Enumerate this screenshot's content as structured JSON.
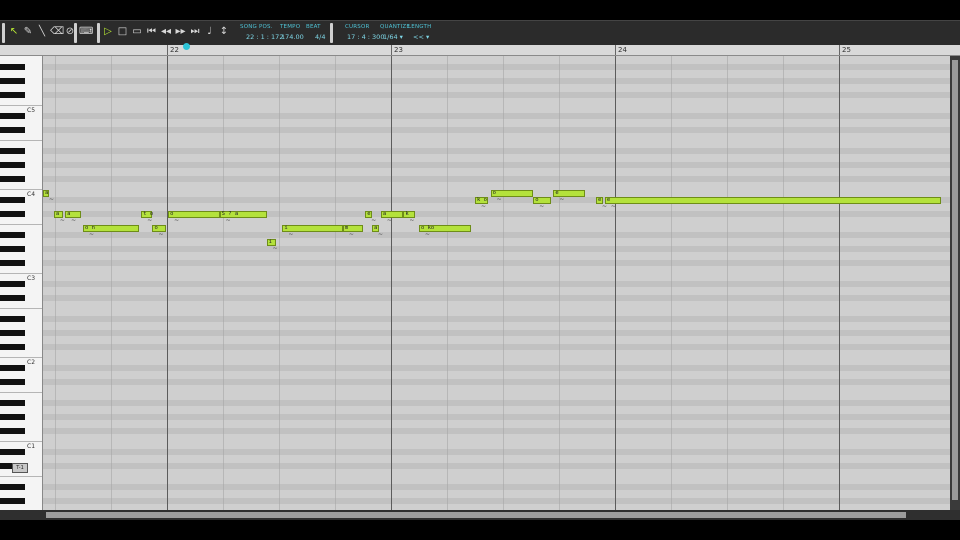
{
  "toolbar": {
    "tools": [
      {
        "name": "arrow-select-tool-icon",
        "glyph": "↖",
        "active": true
      },
      {
        "name": "pencil-tool-icon",
        "glyph": "✎",
        "active": false
      },
      {
        "name": "line-tool-icon",
        "glyph": "╲",
        "active": false
      },
      {
        "name": "eraser-tool-icon",
        "glyph": "⌫",
        "active": false
      },
      {
        "name": "mute-tool-icon",
        "glyph": "⊘",
        "active": false
      }
    ],
    "transport": [
      {
        "name": "play-icon",
        "glyph": "▷",
        "active": true
      },
      {
        "name": "stop-icon",
        "glyph": "□",
        "active": false
      },
      {
        "name": "loop-icon",
        "glyph": "▭",
        "active": false
      },
      {
        "name": "rewind-start-icon",
        "glyph": "⏮",
        "active": false
      },
      {
        "name": "rewind-icon",
        "glyph": "◂◂",
        "active": false
      },
      {
        "name": "forward-icon",
        "glyph": "▸▸",
        "active": false
      },
      {
        "name": "forward-end-icon",
        "glyph": "⏭",
        "active": false
      },
      {
        "name": "metronome-icon",
        "glyph": "♩",
        "active": false
      },
      {
        "name": "pitch-line-icon",
        "glyph": "↕",
        "active": false
      }
    ],
    "song_pos_label": "SONG POS.",
    "song_pos": "22 : 1 : 172",
    "tempo_label": "TEMPO",
    "tempo": "174.00",
    "beat_label": "BEAT",
    "beat": "4/4",
    "cursor_label": "CURSOR",
    "cursor": "17 : 4 : 300",
    "quantize_label": "QUANTIZE",
    "quantize": "1/64 ▾",
    "length_label": "LENGTH",
    "length": "<< ▾"
  },
  "ruler": {
    "bars": [
      "22",
      "23",
      "24",
      "25"
    ]
  },
  "keyboard": {
    "octaves": [
      "C5",
      "C4",
      "C3",
      "C2",
      "C1"
    ],
    "badge": "T-1"
  },
  "notes": [
    {
      "lyric": "a",
      "bar": 21.0,
      "len": 0.02,
      "row": 19
    },
    {
      "lyric": "a",
      "bar": 21.05,
      "len": 0.04,
      "row": 22
    },
    {
      "lyric": "a",
      "bar": 21.1,
      "len": 0.07,
      "row": 22
    },
    {
      "lyric": "o n",
      "bar": 21.18,
      "len": 0.25,
      "row": 24
    },
    {
      "lyric": "t o",
      "bar": 21.44,
      "len": 0.05,
      "row": 22
    },
    {
      "lyric": "o",
      "bar": 21.49,
      "len": 0.06,
      "row": 24
    },
    {
      "lyric": "o",
      "bar": 21.56,
      "len": 0.23,
      "row": 22
    },
    {
      "lyric": "S ? a",
      "bar": 21.79,
      "len": 0.21,
      "row": 22
    },
    {
      "lyric": "i",
      "bar": 22.0,
      "len": 0.04,
      "row": 26
    },
    {
      "lyric": "i",
      "bar": 22.07,
      "len": 0.27,
      "row": 24
    },
    {
      "lyric": "m",
      "bar": 22.34,
      "len": 0.09,
      "row": 24
    },
    {
      "lyric": "e",
      "bar": 22.44,
      "len": 0.03,
      "row": 22
    },
    {
      "lyric": "a",
      "bar": 22.47,
      "len": 0.03,
      "row": 24
    },
    {
      "lyric": "a",
      "bar": 22.51,
      "len": 0.1,
      "row": 22
    },
    {
      "lyric": "k",
      "bar": 22.61,
      "len": 0.05,
      "row": 22
    },
    {
      "lyric": "o ko",
      "bar": 22.68,
      "len": 0.23,
      "row": 24
    },
    {
      "lyric": "k o",
      "bar": 22.93,
      "len": 0.06,
      "row": 20
    },
    {
      "lyric": "o",
      "bar": 23.0,
      "len": 0.19,
      "row": 19
    },
    {
      "lyric": "o",
      "bar": 23.19,
      "len": 0.08,
      "row": 20
    },
    {
      "lyric": "e",
      "bar": 23.28,
      "len": 0.14,
      "row": 19
    },
    {
      "lyric": "e",
      "bar": 23.47,
      "len": 0.03,
      "row": 20
    },
    {
      "lyric": "e",
      "bar": 23.51,
      "len": 1.5,
      "row": 20
    }
  ]
}
